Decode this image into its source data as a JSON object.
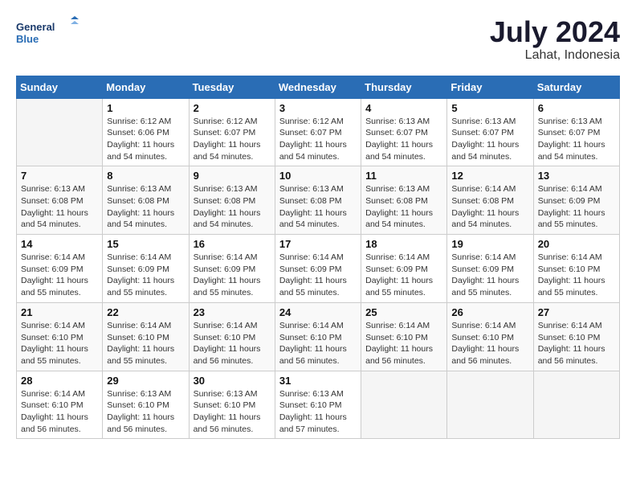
{
  "header": {
    "logo_line1": "General",
    "logo_line2": "Blue",
    "month": "July 2024",
    "location": "Lahat, Indonesia"
  },
  "weekdays": [
    "Sunday",
    "Monday",
    "Tuesday",
    "Wednesday",
    "Thursday",
    "Friday",
    "Saturday"
  ],
  "weeks": [
    [
      {
        "day": "",
        "sunrise": "",
        "sunset": "",
        "daylight": ""
      },
      {
        "day": "1",
        "sunrise": "6:12 AM",
        "sunset": "6:06 PM",
        "daylight": "11 hours and 54 minutes."
      },
      {
        "day": "2",
        "sunrise": "6:12 AM",
        "sunset": "6:07 PM",
        "daylight": "11 hours and 54 minutes."
      },
      {
        "day": "3",
        "sunrise": "6:12 AM",
        "sunset": "6:07 PM",
        "daylight": "11 hours and 54 minutes."
      },
      {
        "day": "4",
        "sunrise": "6:13 AM",
        "sunset": "6:07 PM",
        "daylight": "11 hours and 54 minutes."
      },
      {
        "day": "5",
        "sunrise": "6:13 AM",
        "sunset": "6:07 PM",
        "daylight": "11 hours and 54 minutes."
      },
      {
        "day": "6",
        "sunrise": "6:13 AM",
        "sunset": "6:07 PM",
        "daylight": "11 hours and 54 minutes."
      }
    ],
    [
      {
        "day": "7",
        "sunrise": "6:13 AM",
        "sunset": "6:08 PM",
        "daylight": "11 hours and 54 minutes."
      },
      {
        "day": "8",
        "sunrise": "6:13 AM",
        "sunset": "6:08 PM",
        "daylight": "11 hours and 54 minutes."
      },
      {
        "day": "9",
        "sunrise": "6:13 AM",
        "sunset": "6:08 PM",
        "daylight": "11 hours and 54 minutes."
      },
      {
        "day": "10",
        "sunrise": "6:13 AM",
        "sunset": "6:08 PM",
        "daylight": "11 hours and 54 minutes."
      },
      {
        "day": "11",
        "sunrise": "6:13 AM",
        "sunset": "6:08 PM",
        "daylight": "11 hours and 54 minutes."
      },
      {
        "day": "12",
        "sunrise": "6:14 AM",
        "sunset": "6:08 PM",
        "daylight": "11 hours and 54 minutes."
      },
      {
        "day": "13",
        "sunrise": "6:14 AM",
        "sunset": "6:09 PM",
        "daylight": "11 hours and 55 minutes."
      }
    ],
    [
      {
        "day": "14",
        "sunrise": "6:14 AM",
        "sunset": "6:09 PM",
        "daylight": "11 hours and 55 minutes."
      },
      {
        "day": "15",
        "sunrise": "6:14 AM",
        "sunset": "6:09 PM",
        "daylight": "11 hours and 55 minutes."
      },
      {
        "day": "16",
        "sunrise": "6:14 AM",
        "sunset": "6:09 PM",
        "daylight": "11 hours and 55 minutes."
      },
      {
        "day": "17",
        "sunrise": "6:14 AM",
        "sunset": "6:09 PM",
        "daylight": "11 hours and 55 minutes."
      },
      {
        "day": "18",
        "sunrise": "6:14 AM",
        "sunset": "6:09 PM",
        "daylight": "11 hours and 55 minutes."
      },
      {
        "day": "19",
        "sunrise": "6:14 AM",
        "sunset": "6:09 PM",
        "daylight": "11 hours and 55 minutes."
      },
      {
        "day": "20",
        "sunrise": "6:14 AM",
        "sunset": "6:10 PM",
        "daylight": "11 hours and 55 minutes."
      }
    ],
    [
      {
        "day": "21",
        "sunrise": "6:14 AM",
        "sunset": "6:10 PM",
        "daylight": "11 hours and 55 minutes."
      },
      {
        "day": "22",
        "sunrise": "6:14 AM",
        "sunset": "6:10 PM",
        "daylight": "11 hours and 55 minutes."
      },
      {
        "day": "23",
        "sunrise": "6:14 AM",
        "sunset": "6:10 PM",
        "daylight": "11 hours and 56 minutes."
      },
      {
        "day": "24",
        "sunrise": "6:14 AM",
        "sunset": "6:10 PM",
        "daylight": "11 hours and 56 minutes."
      },
      {
        "day": "25",
        "sunrise": "6:14 AM",
        "sunset": "6:10 PM",
        "daylight": "11 hours and 56 minutes."
      },
      {
        "day": "26",
        "sunrise": "6:14 AM",
        "sunset": "6:10 PM",
        "daylight": "11 hours and 56 minutes."
      },
      {
        "day": "27",
        "sunrise": "6:14 AM",
        "sunset": "6:10 PM",
        "daylight": "11 hours and 56 minutes."
      }
    ],
    [
      {
        "day": "28",
        "sunrise": "6:14 AM",
        "sunset": "6:10 PM",
        "daylight": "11 hours and 56 minutes."
      },
      {
        "day": "29",
        "sunrise": "6:13 AM",
        "sunset": "6:10 PM",
        "daylight": "11 hours and 56 minutes."
      },
      {
        "day": "30",
        "sunrise": "6:13 AM",
        "sunset": "6:10 PM",
        "daylight": "11 hours and 56 minutes."
      },
      {
        "day": "31",
        "sunrise": "6:13 AM",
        "sunset": "6:10 PM",
        "daylight": "11 hours and 57 minutes."
      },
      {
        "day": "",
        "sunrise": "",
        "sunset": "",
        "daylight": ""
      },
      {
        "day": "",
        "sunrise": "",
        "sunset": "",
        "daylight": ""
      },
      {
        "day": "",
        "sunrise": "",
        "sunset": "",
        "daylight": ""
      }
    ]
  ]
}
